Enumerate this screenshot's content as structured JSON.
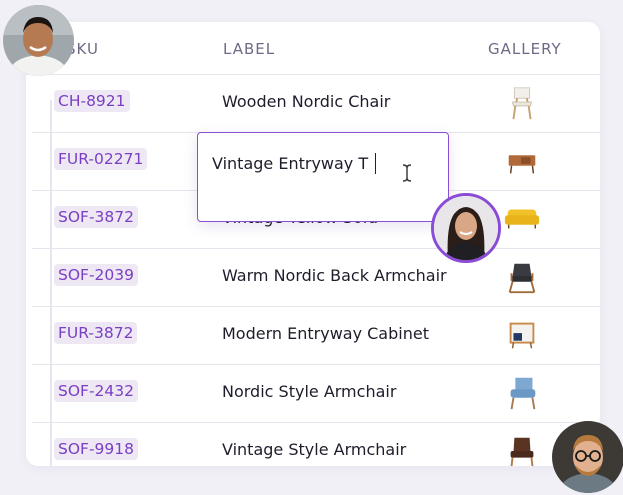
{
  "table": {
    "headers": {
      "sku": "SKU",
      "label": "LABEL",
      "gallery": "GALLERY"
    },
    "rows": [
      {
        "sku": "CH-8921",
        "label": "Wooden Nordic Chair",
        "image": "white-wooden-chair"
      },
      {
        "sku": "FUR-02271",
        "label": "",
        "image": "wooden-sideboard"
      },
      {
        "sku": "SOF-3872",
        "label": "Vintage Yellow Sofa",
        "image": "yellow-sofa"
      },
      {
        "sku": "SOF-2039",
        "label": "Warm Nordic Back Armchair",
        "image": "dark-armchair"
      },
      {
        "sku": "FUR-3872",
        "label": "Modern Entryway Cabinet",
        "image": "entryway-cabinet"
      },
      {
        "sku": "SOF-2432",
        "label": "Nordic Style Armchair",
        "image": "blue-armchair"
      },
      {
        "sku": "SOF-9918",
        "label": "Vintage Style Armchair",
        "image": "brown-armchair"
      }
    ]
  },
  "editor": {
    "value": "Vintage Entryway T"
  },
  "collaborators": [
    "user-avatar-top-left",
    "user-avatar-editing",
    "user-avatar-bottom-right"
  ],
  "colors": {
    "accent": "#8a50d4",
    "sku_text": "#7b3fc4",
    "sku_bg": "#ede8f4"
  }
}
